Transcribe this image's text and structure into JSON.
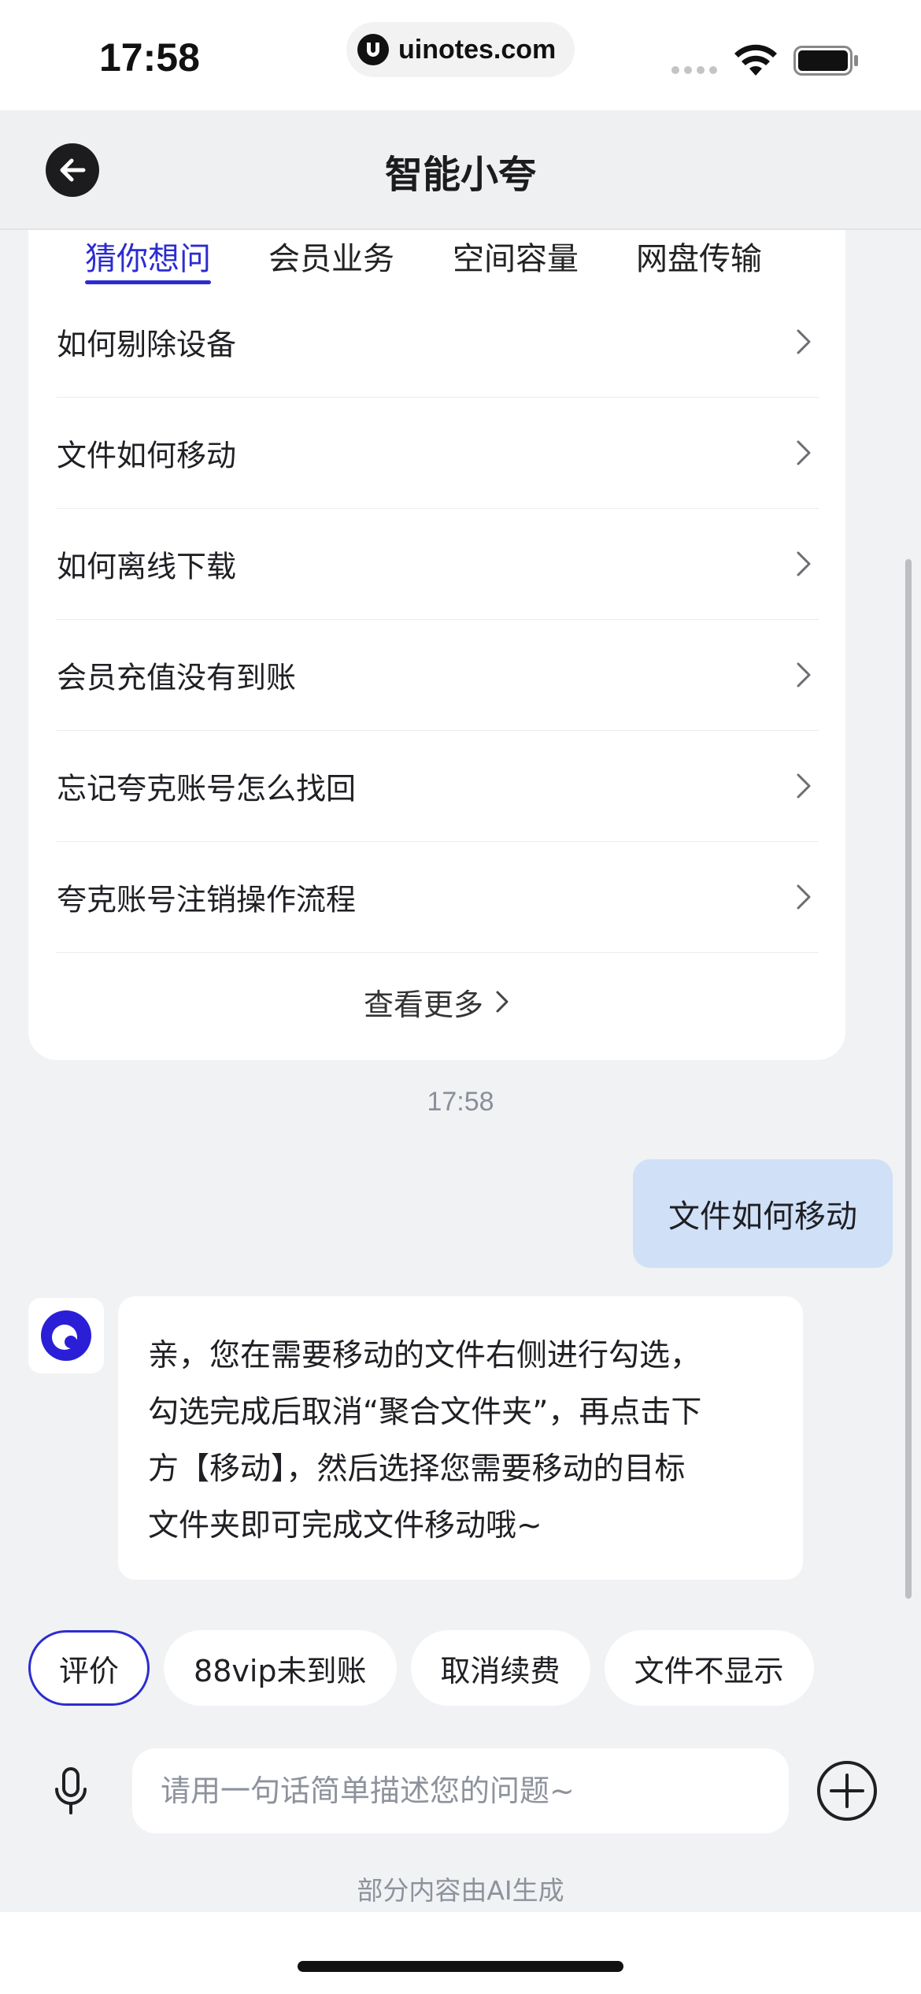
{
  "status_bar": {
    "time": "17:58",
    "url": "uinotes.com"
  },
  "header": {
    "title": "智能小夸"
  },
  "tabs": [
    {
      "label": "猜你想问",
      "active": true
    },
    {
      "label": "会员业务",
      "active": false
    },
    {
      "label": "空间容量",
      "active": false
    },
    {
      "label": "网盘传输",
      "active": false
    }
  ],
  "faq": [
    {
      "label": "如何剔除设备"
    },
    {
      "label": "文件如何移动"
    },
    {
      "label": "如何离线下载"
    },
    {
      "label": "会员充值没有到账"
    },
    {
      "label": "忘记夸克账号怎么找回"
    },
    {
      "label": "夸克账号注销操作流程"
    }
  ],
  "see_more_label": "查看更多",
  "chat": {
    "timestamp": "17:58",
    "user_message": "文件如何移动",
    "bot_message_lines": [
      "亲，您在需要移动的文件右侧进行勾选，",
      "勾选完成后取消“聚合文件夹”，再点击下",
      "方【移动】，然后选择您需要移动的目标",
      "文件夹即可完成文件移动哦~"
    ]
  },
  "quick_replies": [
    {
      "label": "评价",
      "active": true
    },
    {
      "label": "88vip未到账",
      "active": false
    },
    {
      "label": "取消续费",
      "active": false
    },
    {
      "label": "文件不显示",
      "active": false
    }
  ],
  "input": {
    "placeholder": "请用一句话简单描述您的问题~",
    "value": ""
  },
  "ai_notice": "部分内容由AI生成",
  "colors": {
    "accent": "#2c2cd0",
    "user_bubble": "#cfe0f7",
    "background": "#f1f2f4"
  },
  "icons": {
    "back": "arrow-left-icon",
    "chevron": "chevron-right-icon",
    "mic": "microphone-icon",
    "add": "plus-circle-icon",
    "avatar": "quark-logo-icon"
  }
}
